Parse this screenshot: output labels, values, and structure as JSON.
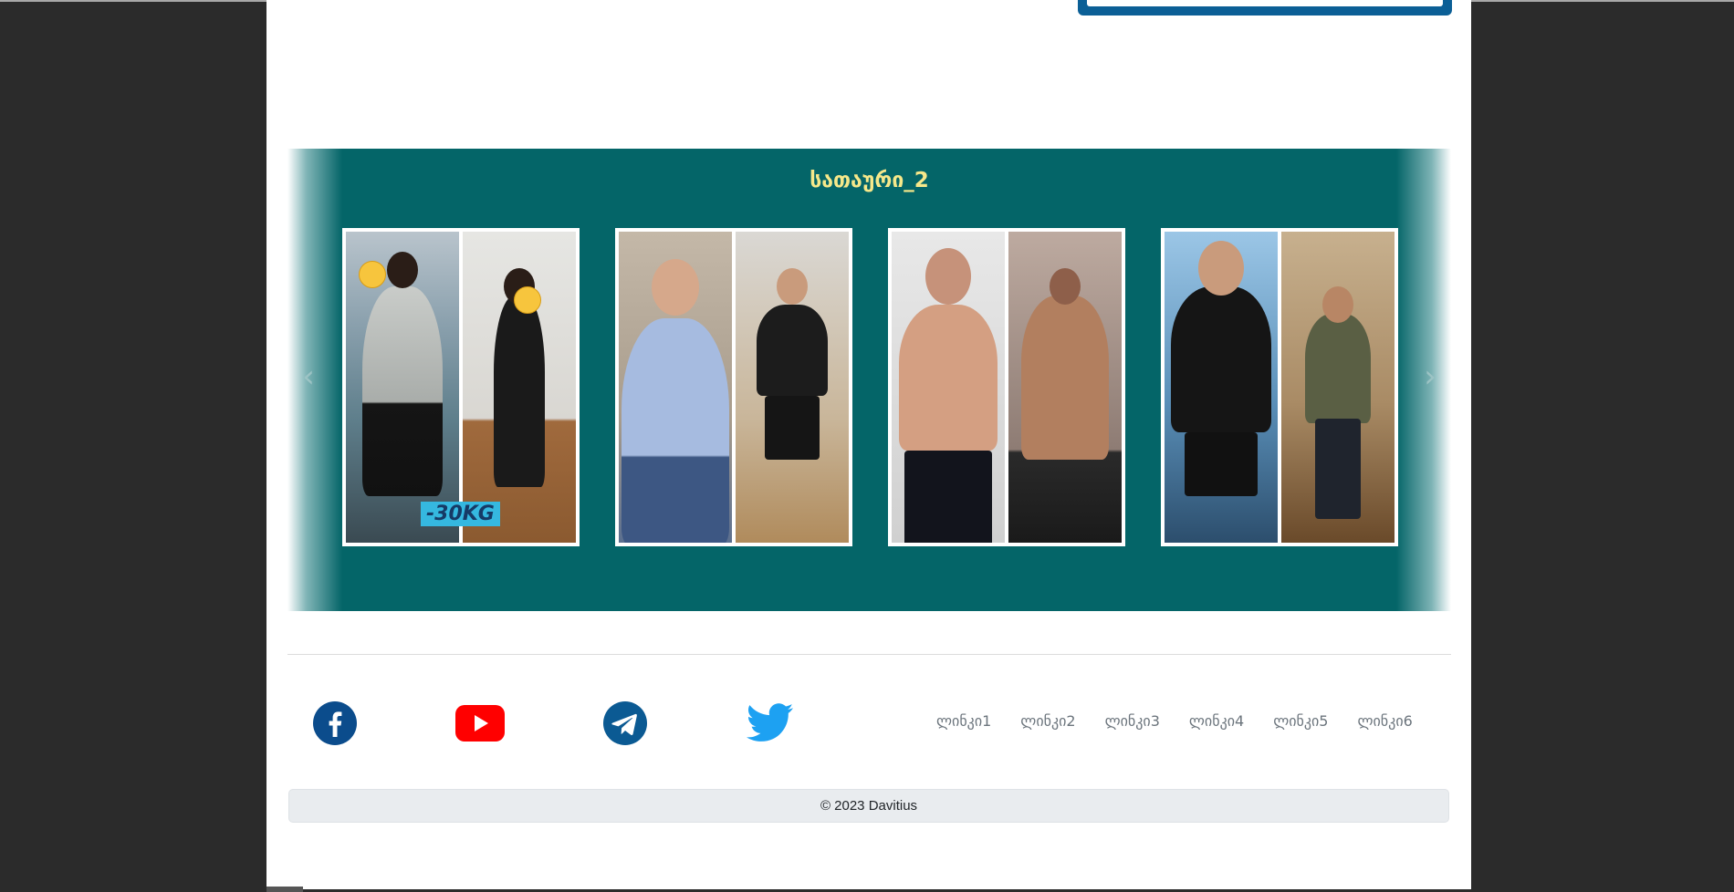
{
  "gallery": {
    "title": "სათაური_2",
    "prev_icon": "chevron-left-icon",
    "next_icon": "chevron-right-icon",
    "photos": [
      {
        "badge": "-30KG"
      },
      {
        "badge": ""
      },
      {
        "badge": ""
      },
      {
        "badge": ""
      }
    ]
  },
  "footer": {
    "social": [
      {
        "name": "facebook-icon",
        "color": "#0b4c8c"
      },
      {
        "name": "youtube-icon",
        "color": "#ff0000"
      },
      {
        "name": "telegram-icon",
        "color": "#0b5a93"
      },
      {
        "name": "twitter-icon",
        "color": "#1da1f2"
      }
    ],
    "links": [
      "ლინკი1",
      "ლინკი2",
      "ლინკი3",
      "ლინკი4",
      "ლინკი5",
      "ლინკი6"
    ],
    "copyright": "© 2023 Davitius"
  },
  "colors": {
    "gallery_bg": "#046568",
    "title": "#f6e88a",
    "page_bg": "#2b2b2b"
  }
}
